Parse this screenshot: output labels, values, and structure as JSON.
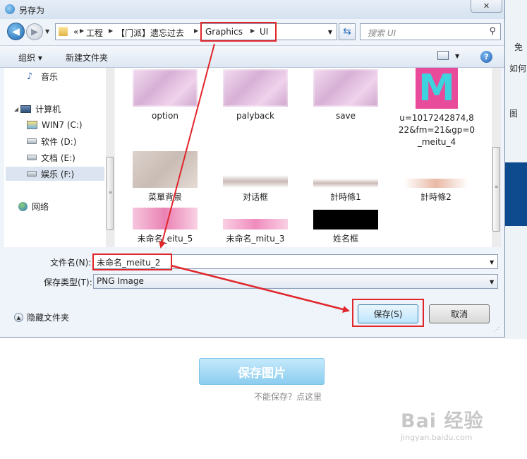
{
  "background_page": {
    "side_link_1": "免",
    "side_link_2": "如何",
    "side_link_3": "图",
    "save_image_button": "保存图片",
    "cannot_save_link": "不能保存？点这里",
    "watermark_main": "Bai 经验",
    "watermark_sub": "jingyan.baidu.com"
  },
  "dialog": {
    "title": "另存为",
    "close_label": "✕",
    "nav": {
      "back_label": "◀",
      "forward_label": "▶",
      "breadcrumb": [
        "«",
        "工程",
        "【门派】遗忘过去",
        "Graphics",
        "UI"
      ],
      "search_placeholder": "搜索 UI"
    },
    "toolbar": {
      "organize": "组织 ▾",
      "new_folder": "新建文件夹",
      "help_label": "?"
    },
    "nav_pane": {
      "music": "音乐",
      "computer": "计算机",
      "drives": [
        "WIN7 (C:)",
        "软件 (D:)",
        "文档 (E:)",
        "娱乐 (F:)"
      ],
      "network": "网络"
    },
    "files": [
      {
        "name": "option"
      },
      {
        "name": "palyback"
      },
      {
        "name": "save"
      },
      {
        "name": "u=1017242874,822&fm=21&gp=0_meitu_4",
        "thumb_text": "M"
      },
      {
        "name": "菜單背景"
      },
      {
        "name": "对话框"
      },
      {
        "name": "計時條1"
      },
      {
        "name": "計時條2"
      },
      {
        "name": "未命名_eitu_5"
      },
      {
        "name": "未命名_mitu_3"
      },
      {
        "name": "姓名框"
      }
    ],
    "form": {
      "filename_label": "文件名(N):",
      "filename_value": "未命名_meitu_2",
      "filetype_label": "保存类型(T):",
      "filetype_value": "PNG Image",
      "hide_folders": "隐藏文件夹",
      "save": "保存(S)",
      "cancel": "取消"
    }
  },
  "colors": {
    "annotation_red": "#e0262b",
    "dialog_bg": "#eff4fa",
    "save_image_blue": "#8ccdef"
  }
}
